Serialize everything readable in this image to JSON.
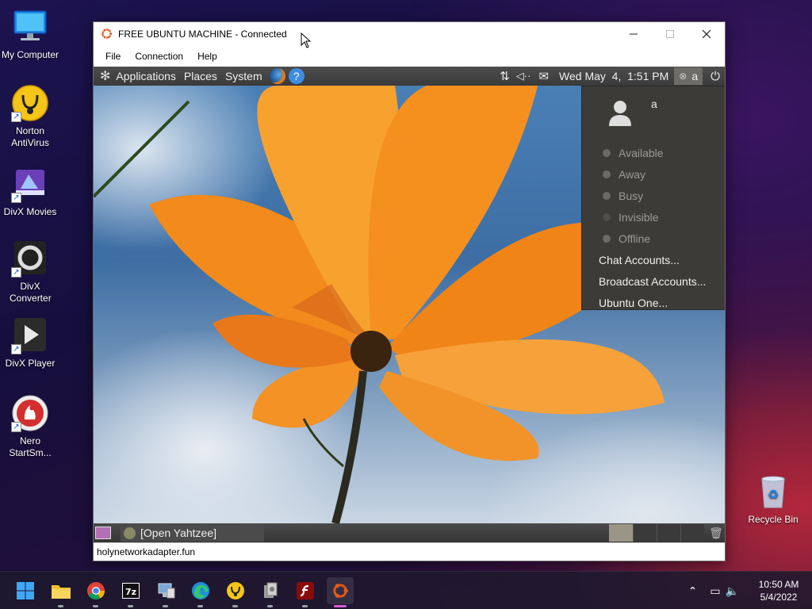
{
  "desktop": {
    "icons": [
      {
        "label": "My Computer"
      },
      {
        "label": "Norton AntiVirus"
      },
      {
        "label": "DivX Movies"
      },
      {
        "label": "DivX Converter"
      },
      {
        "label": "DivX Player"
      },
      {
        "label": "Nero StartSm..."
      }
    ],
    "recycle_bin": "Recycle Bin"
  },
  "window": {
    "title": "FREE UBUNTU MACHINE - Connected",
    "menu": [
      "File",
      "Connection",
      "Help"
    ],
    "status_url": "holynetworkadapter.fun"
  },
  "ubuntu": {
    "top_panel": {
      "menus": [
        "Applications",
        "Places",
        "System"
      ],
      "datetime": "Wed May  4,  1:51 PM",
      "user": "a"
    },
    "dropdown": {
      "username": "a",
      "statuses": [
        "Available",
        "Away",
        "Busy",
        "Invisible",
        "Offline"
      ],
      "links": [
        "Chat Accounts...",
        "Broadcast Accounts...",
        "Ubuntu One..."
      ]
    },
    "bottom_panel": {
      "task": "[Open Yahtzee]"
    }
  },
  "taskbar": {
    "time": "10:50 AM",
    "date": "5/4/2022"
  }
}
